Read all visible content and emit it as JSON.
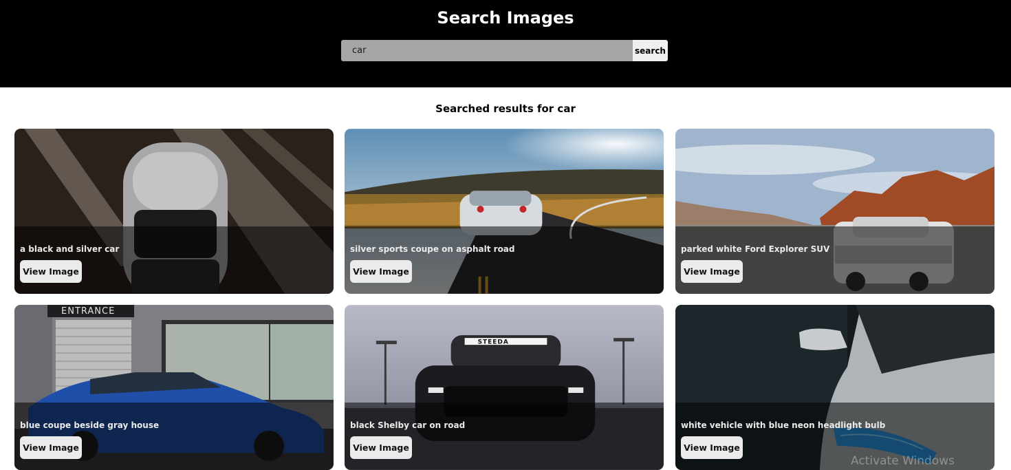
{
  "header": {
    "title": "Search Images",
    "search_value": "car",
    "search_button": "search"
  },
  "results": {
    "heading": "Searched results for car",
    "cards": [
      {
        "caption": "a black and silver car",
        "button": "View Image"
      },
      {
        "caption": "silver sports coupe on asphalt road",
        "button": "View Image"
      },
      {
        "caption": "parked white Ford Explorer SUV",
        "button": "View Image"
      },
      {
        "caption": "blue coupe beside gray house",
        "button": "View Image"
      },
      {
        "caption": "black Shelby car on road",
        "button": "View Image"
      },
      {
        "caption": "white vehicle with blue neon headlight bulb",
        "button": "View Image"
      }
    ]
  },
  "photo_texts": {
    "entrance_sign": "ENTRANCE",
    "windshield_banner": "STEEDA"
  },
  "watermark": "Activate Windows",
  "colors": {
    "header_bg": "#000000",
    "search_field_bg": "#a6a6a6",
    "search_button_bg": "#f0f0f0",
    "view_button_bg": "#ebebeb"
  }
}
